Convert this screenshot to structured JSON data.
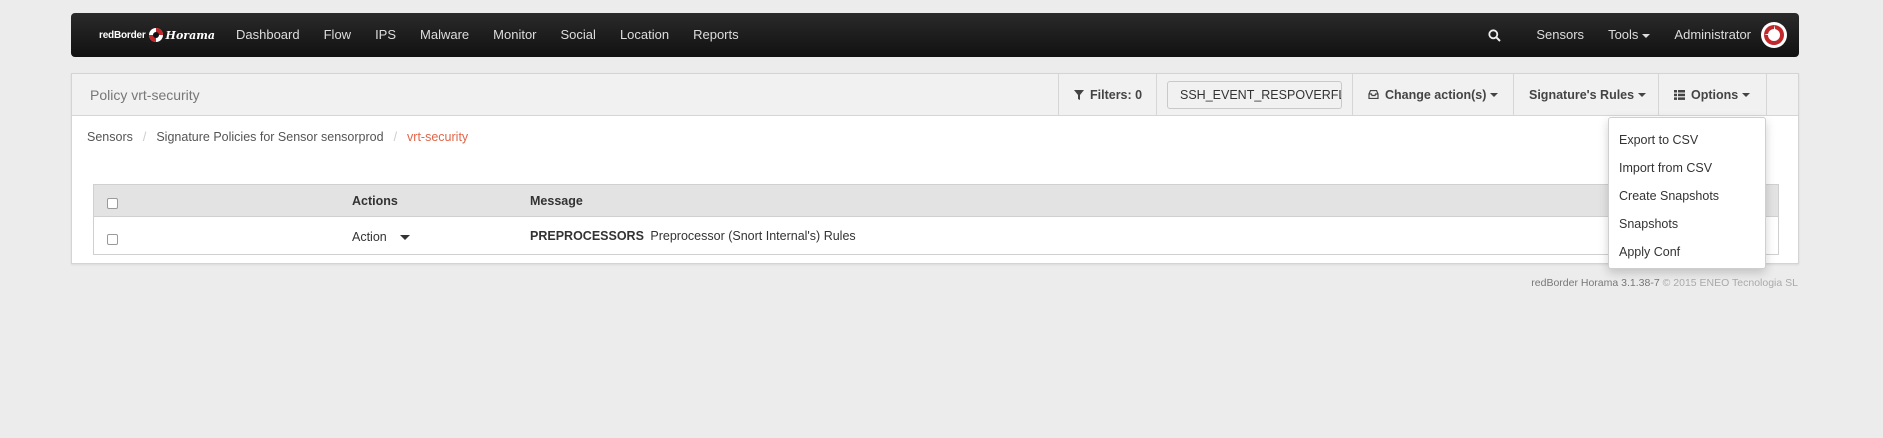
{
  "navbar": {
    "brand_a": "redBorder",
    "brand_b": "Horama",
    "left_items": [
      "Dashboard",
      "Flow",
      "IPS",
      "Malware",
      "Monitor",
      "Social",
      "Location",
      "Reports"
    ],
    "right_items": {
      "sensors": "Sensors",
      "tools": "Tools",
      "user": "Administrator"
    }
  },
  "panel": {
    "title": "Policy vrt-security",
    "filters_label": "Filters: 0",
    "filter_value": "SSH_EVENT_RESPOVERFLOW",
    "change_actions": "Change action(s)",
    "signature_rules": "Signature's Rules",
    "options": "Options"
  },
  "breadcrumb": {
    "items": [
      "Sensors",
      "Signature Policies for Sensor sensorprod"
    ],
    "active": "vrt-security",
    "separator": "/"
  },
  "table": {
    "headers": {
      "actions": "Actions",
      "message": "Message"
    },
    "rows": [
      {
        "action": "Action",
        "message_strong": "PREPROCESSORS",
        "message_rest": "Preprocessor (Snort Internal's) Rules"
      }
    ]
  },
  "options_menu": {
    "items": [
      "Export to CSV",
      "Import from CSV",
      "Create Snapshots",
      "Snapshots",
      "Apply Conf"
    ]
  },
  "footer": {
    "version": "redBorder Horama 3.1.38-7",
    "copyright": "© 2015 ENEO Tecnologia SL"
  },
  "colors": {
    "accent": "#e0664a",
    "navbar": "#1a1a1a"
  }
}
